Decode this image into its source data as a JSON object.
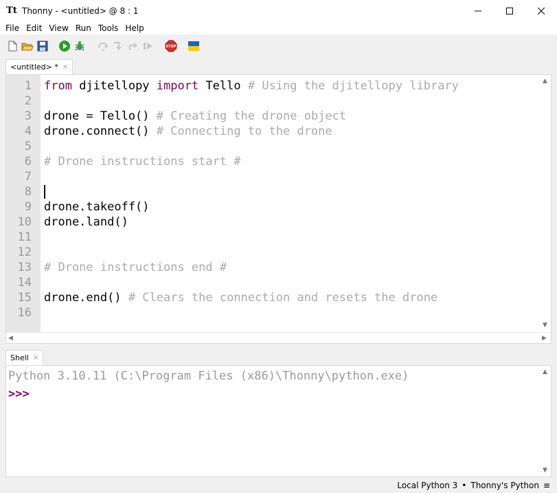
{
  "window": {
    "title": "Thonny  -  <untitled>  @  8 : 1",
    "app_icon_text": "Tt"
  },
  "menu": [
    "File",
    "Edit",
    "View",
    "Run",
    "Tools",
    "Help"
  ],
  "toolbar": {
    "icons": [
      "new-file-icon",
      "open-file-icon",
      "save-icon",
      "run-icon",
      "debug-icon",
      "step-over-icon",
      "step-into-icon",
      "step-out-icon",
      "resume-icon",
      "stop-icon",
      "ukraine-flag-icon"
    ],
    "stop_label": "STOP"
  },
  "editor": {
    "tab_label": "<untitled> *",
    "tab_close": "×",
    "line_numbers": [
      "1",
      "2",
      "3",
      "4",
      "5",
      "6",
      "7",
      "8",
      "9",
      "10",
      "11",
      "12",
      "13",
      "14",
      "15",
      "16"
    ],
    "lines": [
      {
        "kw1": "from",
        "t1": " djitellopy ",
        "kw2": "import",
        "t2": " Tello ",
        "cm": "# Using the djitellopy library"
      },
      {
        "t1": ""
      },
      {
        "t1": "drone = Tello() ",
        "cm": "# Creating the drone object"
      },
      {
        "t1": "drone.connect() ",
        "cm": "# Connecting to the drone"
      },
      {
        "t1": ""
      },
      {
        "cm": "# Drone instructions start #"
      },
      {
        "t1": ""
      },
      {
        "t1": ""
      },
      {
        "t1": "drone.takeoff()"
      },
      {
        "t1": "drone.land()"
      },
      {
        "t1": ""
      },
      {
        "t1": ""
      },
      {
        "cm": "# Drone instructions end #"
      },
      {
        "t1": ""
      },
      {
        "t1": "drone.end() ",
        "cm": "# Clears the connection and resets the drone"
      },
      {
        "t1": ""
      }
    ],
    "cursor_line": 8
  },
  "shell": {
    "tab_label": "Shell",
    "tab_close": "×",
    "banner": "Python 3.10.11 (C:\\Program Files (x86)\\Thonny\\python.exe)",
    "prompt": ">>>"
  },
  "status": {
    "interpreter": "Local Python 3",
    "separator": "•",
    "variant": "Thonny's Python",
    "menu_icon": "≡"
  },
  "colors": {
    "keyword": "#7f0055",
    "comment": "#aaaaaa",
    "prompt": "#800080",
    "gutter": "#e7e7e7",
    "run_green": "#2a9d2a",
    "stop_red": "#d32f2f",
    "flag_blue": "#1f5fc7",
    "flag_yellow": "#f6cc12"
  }
}
